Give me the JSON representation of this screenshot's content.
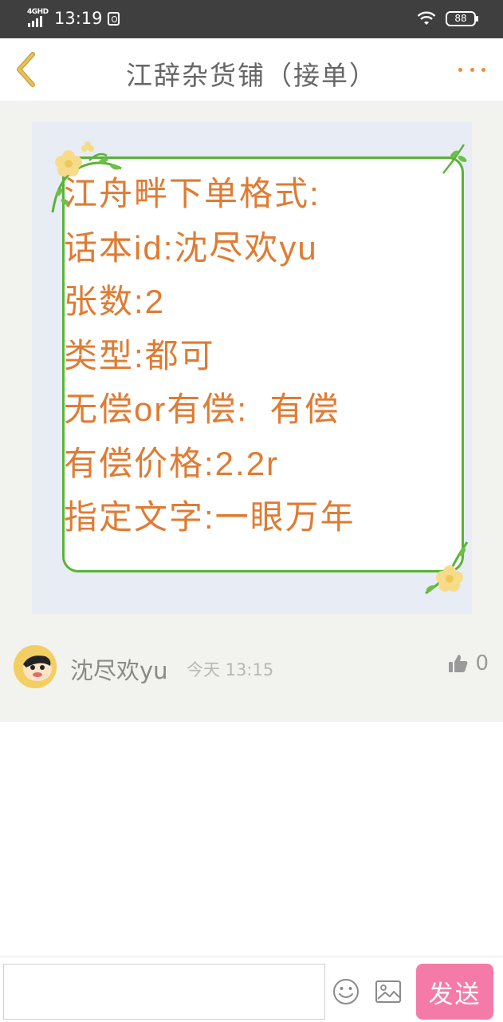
{
  "status_bar": {
    "network": "4GHD",
    "time": "13:19",
    "battery": "88",
    "icons": [
      "signal-icon",
      "sync-icon",
      "wifi-icon",
      "battery-icon"
    ]
  },
  "header": {
    "title": "江辞杂货铺（接单）",
    "back_icon": "chevron-left-icon",
    "more_icon": "more-dots-icon"
  },
  "post": {
    "image_lines": [
      "江舟畔下单格式:",
      "话本id:沈尽欢yu",
      "张数:2",
      "类型:都可",
      "无偿or有偿:  有偿",
      "有偿价格:2.2r",
      "指定文字:一眼万年"
    ],
    "author": "沈尽欢yu",
    "time": "今天 13:15",
    "like_count": "0"
  },
  "reply_bar": {
    "input_value": "",
    "input_placeholder": "",
    "send_label": "发送"
  },
  "colors": {
    "accent_orange": "#f08a3d",
    "send_pink": "#f47ba7",
    "frame_green": "#5bb238",
    "text_orange": "#e07b33"
  }
}
